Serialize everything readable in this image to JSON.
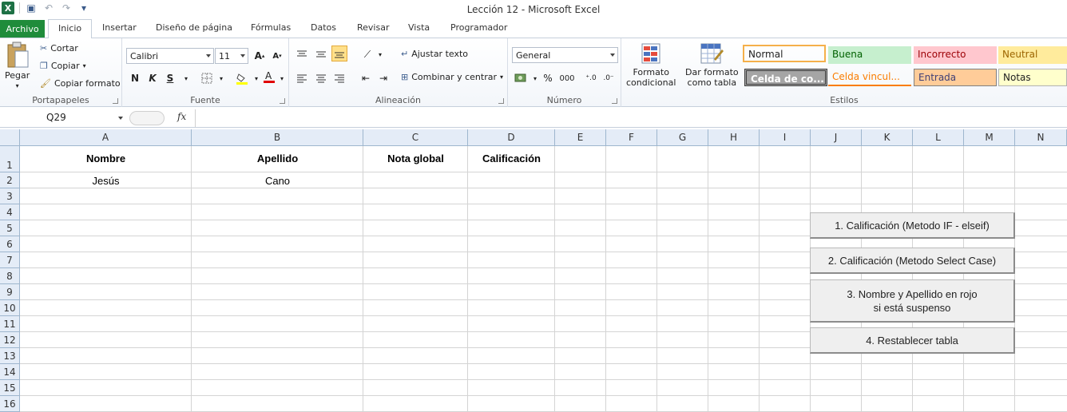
{
  "window": {
    "title": "Lección 12  -  Microsoft Excel"
  },
  "tabs": [
    "Archivo",
    "Inicio",
    "Insertar",
    "Diseño de página",
    "Fórmulas",
    "Datos",
    "Revisar",
    "Vista",
    "Programador"
  ],
  "ribbon": {
    "portapapeles": {
      "label": "Portapapeles",
      "paste": "Pegar",
      "cut": "Cortar",
      "copy": "Copiar",
      "format_painter": "Copiar formato"
    },
    "fuente": {
      "label": "Fuente",
      "font_name": "Calibri",
      "font_size": "11",
      "bold": "N",
      "italic": "K",
      "underline": "S"
    },
    "alineacion": {
      "label": "Alineación",
      "wrap": "Ajustar texto",
      "merge": "Combinar y centrar"
    },
    "numero": {
      "label": "Número",
      "format": "General",
      "percent": "%",
      "thousands": "000"
    },
    "estilos": {
      "label": "Estilos",
      "conditional": "Formato\ncondicional",
      "as_table": "Dar formato\ncomo tabla",
      "cells": [
        {
          "text": "Normal",
          "bg": "#ffffff",
          "fg": "#000000"
        },
        {
          "text": "Buena",
          "bg": "#c6efce",
          "fg": "#006100"
        },
        {
          "text": "Incorrecto",
          "bg": "#ffc7ce",
          "fg": "#9c0006"
        },
        {
          "text": "Neutral",
          "bg": "#ffeb9c",
          "fg": "#9c6500"
        },
        {
          "text": "Celda de co...",
          "bg": "#a5a5a5",
          "fg": "#ffffff"
        },
        {
          "text": "Celda vincul...",
          "bg": "#ffffff",
          "fg": "#fa7d00"
        },
        {
          "text": "Entrada",
          "bg": "#ffcc99",
          "fg": "#3f3f76"
        },
        {
          "text": "Notas",
          "bg": "#ffffcc",
          "fg": "#000000"
        }
      ]
    }
  },
  "formula_bar": {
    "name_box": "Q29",
    "fx": "fx",
    "value": ""
  },
  "sheet": {
    "columns": [
      "A",
      "B",
      "C",
      "D",
      "E",
      "F",
      "G",
      "H",
      "I",
      "J",
      "K",
      "L",
      "M",
      "N"
    ],
    "rows": [
      "1",
      "2",
      "3",
      "4",
      "5",
      "6",
      "7",
      "8",
      "9",
      "10",
      "11",
      "12",
      "13",
      "14",
      "15",
      "16"
    ],
    "headers": [
      "Nombre",
      "Apellido",
      "Nota global",
      "Calificación"
    ],
    "data_row": [
      "Jesús",
      "Cano",
      "",
      ""
    ]
  },
  "macro_buttons": [
    "1. Calificación (Metodo IF - elseif)",
    "2. Calificación (Metodo Select Case)",
    "3. Nombre y Apellido en rojo\nsi está suspenso",
    "4. Restablecer tabla"
  ]
}
